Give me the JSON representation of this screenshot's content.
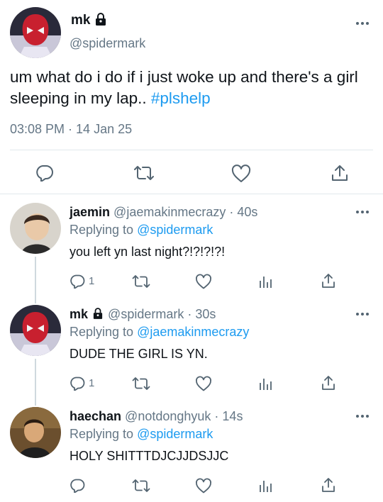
{
  "main_tweet": {
    "display_name": "mk",
    "handle": "@spidermark",
    "text_plain": "um what do i do if i just woke up and there's a girl sleeping in my lap.. ",
    "hashtag": "#plshelp",
    "timestamp": "03:08 PM · 14 Jan 25",
    "actions": [
      "reply-icon",
      "retweet-icon",
      "like-icon",
      "share-icon"
    ]
  },
  "replies": [
    {
      "display_name": "jaemin",
      "handle": "@jaemakinmecrazy",
      "time": "· 40s",
      "replying_prefix": "Replying to",
      "replying_to": "@spidermark",
      "text": "you left yn last night?!?!?!?!",
      "reply_count": "1"
    },
    {
      "display_name": "mk",
      "handle": "@spidermark",
      "time": "· 30s",
      "replying_prefix": "Replying to",
      "replying_to": "@jaemakinmecrazy",
      "text": "DUDE THE GIRL IS YN.",
      "reply_count": "1"
    },
    {
      "display_name": "haechan",
      "handle": "@notdonghyuk",
      "time": "· 14s",
      "replying_prefix": "Replying to",
      "replying_to": "@spidermark",
      "text": "HOLY SHITTTDJCJJDSJJC",
      "reply_count": ""
    }
  ],
  "colors": {
    "link": "#1d9bf0",
    "muted": "#657786",
    "icon": "#536471",
    "divider": "#e1e8ed"
  }
}
